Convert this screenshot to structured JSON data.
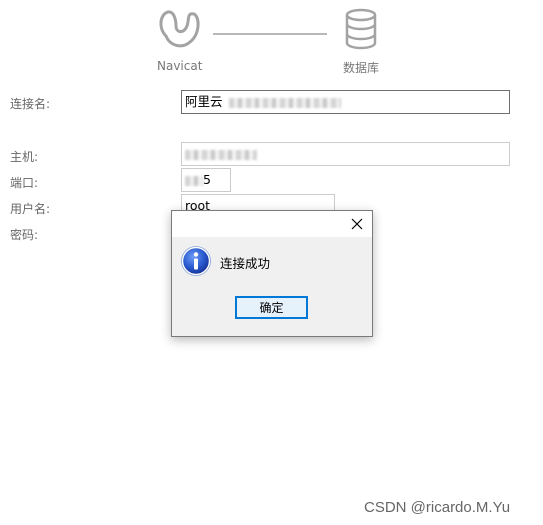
{
  "header": {
    "source_label": "Navicat",
    "target_label": "数据库"
  },
  "form": {
    "connection_name": {
      "label": "连接名:",
      "value": "阿里云"
    },
    "host": {
      "label": "主机:"
    },
    "port": {
      "label": "端口:",
      "value_suffix": "5"
    },
    "username": {
      "label": "用户名:",
      "value": "root"
    },
    "password": {
      "label": "密码:"
    }
  },
  "dialog": {
    "message": "连接成功",
    "ok_label": "确定"
  },
  "watermark": "CSDN @ricardo.M.Yu",
  "colors": {
    "accent": "#0078d7",
    "info_blue": "#1f4fbf"
  }
}
